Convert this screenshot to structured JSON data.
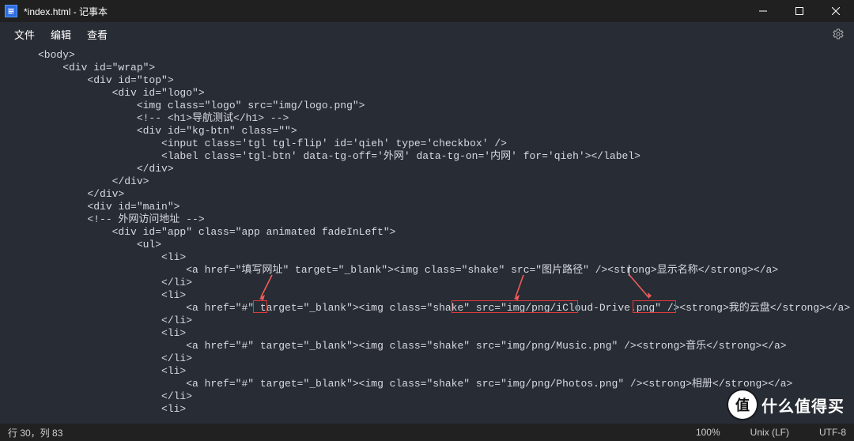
{
  "window": {
    "title": "*index.html - 记事本"
  },
  "menu": {
    "file": "文件",
    "edit": "编辑",
    "view": "查看"
  },
  "status": {
    "pos": "行 30，列 83",
    "zoom": "100%",
    "eol": "Unix (LF)",
    "enc": "UTF-8"
  },
  "code": {
    "l01": "<body>",
    "l02": "    <div id=\"wrap\">",
    "l03": "        <div id=\"top\">",
    "l04": "            <div id=\"logo\">",
    "l05": "                <img class=\"logo\" src=\"img/logo.png\">",
    "l06": "                <!-- <h1>导航测试</h1> -->",
    "l07": "                <div id=\"kg-btn\" class=\"\">",
    "l08": "                    <input class='tgl tgl-flip' id='qieh' type='checkbox' />",
    "l09": "                    <label class='tgl-btn' data-tg-off='外网' data-tg-on='内网' for='qieh'></label>",
    "l10": "                </div>",
    "l11": "            </div>",
    "l12": "        </div>",
    "l13": "        <div id=\"main\">",
    "l14": "        <!-- 外网访问地址 -->",
    "l15": "            <div id=\"app\" class=\"app animated fadeInLeft\">",
    "l16": "                <ul>",
    "l17": "                    <li>",
    "l18": "                        <a href=\"填写网址\" target=\"_blank\"><img class=\"shake\" src=\"图片路径\" /><strong>显示名称</strong></a>",
    "l19": "                    </li>",
    "l20": "                    <li>",
    "l21": "                        <a href=\"#\" target=\"_blank\"><img class=\"shake\" src=\"img/png/iCloud-Drive.png\" /><strong>我的云盘</strong></a>",
    "l22": "                    </li>",
    "l23": "                    <li>",
    "l24": "                        <a href=\"#\" target=\"_blank\"><img class=\"shake\" src=\"img/png/Music.png\" /><strong>音乐</strong></a>",
    "l25": "                    </li>",
    "l26": "                    <li>",
    "l27": "                        <a href=\"#\" target=\"_blank\"><img class=\"shake\" src=\"img/png/Photos.png\" /><strong>相册</strong></a>",
    "l28": "                    </li>",
    "l29": "                    <li>"
  },
  "watermark": {
    "badge": "值",
    "text": "什么值得买"
  }
}
